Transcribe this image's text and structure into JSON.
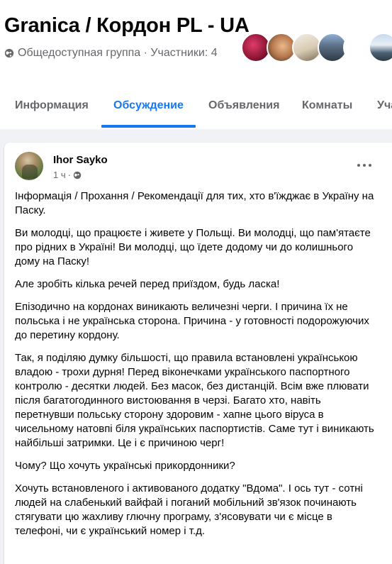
{
  "group": {
    "title": "Granica / Кордон PL - UA",
    "meta": "Общедоступная группа · Участники: 4"
  },
  "tabs": [
    {
      "label": "Информация"
    },
    {
      "label": "Обсуждение"
    },
    {
      "label": "Объявления"
    },
    {
      "label": "Комнаты"
    },
    {
      "label": "Уча"
    }
  ],
  "post": {
    "author": "Ihor Sayko",
    "time": "1 ч",
    "paragraphs": [
      "Інформація / Прохання / Рекомендації для тих, хто в'їжджає в Україну на Паску.",
      "Ви молодці, що працюєте і живете у Польщі. Ви молодці, що пам'ятаєте про рідних в Україні! Ви молодці, що їдете додому чи до колишнього дому на Паску!",
      "Але зробіть кілька речей перед приїздом, будь ласка!",
      "Епізодично на кордонах виникають величезні черги. І причина їх не польська і не українська сторона. Причина - у готовності подорожуючих до перетину кордону.",
      "Так, я поділяю думку більшості, що правила встановлені українською владою - трохи дурня! Перед віконечками українського паспортного контролю - десятки людей. Без масок, без дистанцій. Всім вже плювати після багатогодинного вистоювання в черзі. Багато хто, навіть перетнувши польську сторону здоровим - хапне цього віруса в чисельному натовпі біля українських паспортистів. Саме тут і виникають найбільші затримки. Це і є причиною черг!",
      "Чому? Що хочуть українські прикордонники?",
      "Хочуть встановленого і активованого додатку \"Вдома\". І ось тут - сотні людей на слабенький вайфай і поганий мобільний зв'язок починають стягувати цю жахливу глючну програму, з'ясовувати чи є місце в телефоні, чи є український номер і т.д."
    ]
  },
  "colors": {
    "accent": "#1877f2",
    "muted": "#65676b",
    "background": "#f0f2f5"
  },
  "icons": {
    "globe": "globe-icon",
    "privacy": "globe-icon",
    "more": "more-horizontal-icon"
  }
}
